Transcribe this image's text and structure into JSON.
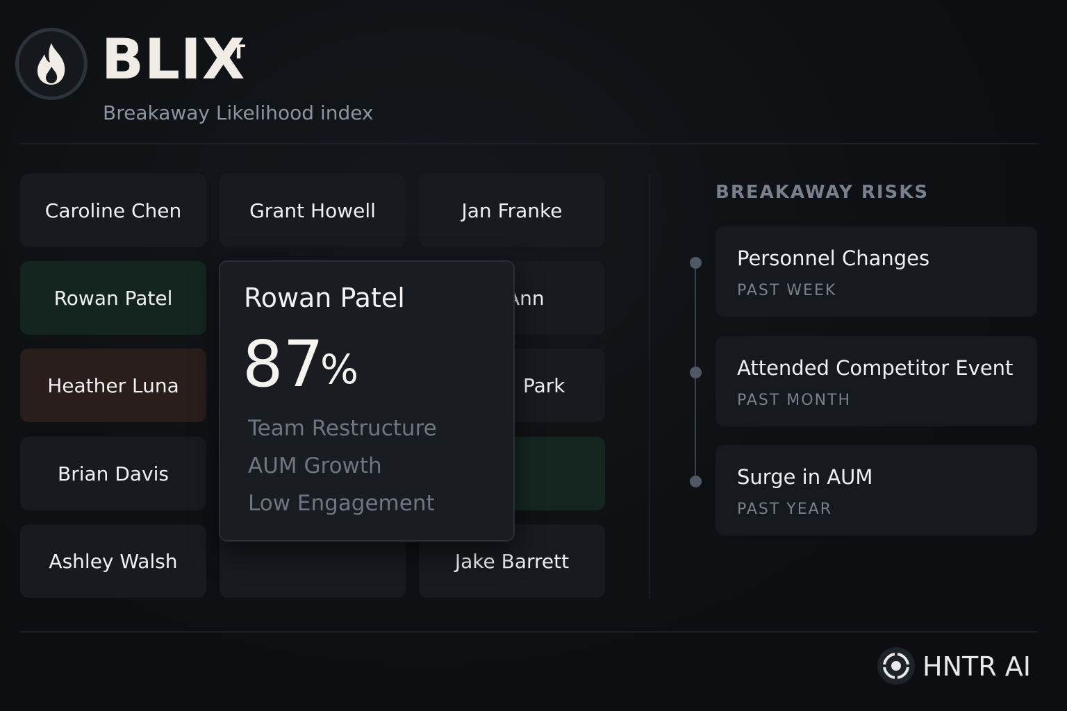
{
  "header": {
    "brand": "BLIX",
    "brand_superscript": "T",
    "subtitle": "Breakaway Likelihood index",
    "logo_icon": "flame-icon"
  },
  "advisors": [
    {
      "name": "Caroline Chen",
      "tint": "default"
    },
    {
      "name": "Grant Howell",
      "tint": "default"
    },
    {
      "name": "Jan Franke",
      "tint": "default"
    },
    {
      "name": "Rowan Patel",
      "tint": "green"
    },
    {
      "name": "Ann",
      "tint": "default"
    },
    {
      "name": "Heather Luna",
      "tint": "brown"
    },
    {
      "name": "Park",
      "tint": "default"
    },
    {
      "name": "Brian Davis",
      "tint": "default"
    },
    {
      "name": "",
      "tint": "green"
    },
    {
      "name": "Ashley Walsh",
      "tint": "default"
    },
    {
      "name": "",
      "tint": "default"
    },
    {
      "name": "Jake Barrett",
      "tint": "default"
    }
  ],
  "popup": {
    "name": "Rowan Patel",
    "score": "87",
    "score_unit": "%",
    "factors": [
      "Team Restructure",
      "AUM Growth",
      "Low Engagement"
    ]
  },
  "risks": {
    "title": "BREAKAWAY RISKS",
    "items": [
      {
        "title": "Personnel Changes",
        "when": "PAST WEEK"
      },
      {
        "title": "Attended Competitor Event",
        "when": "PAST MONTH"
      },
      {
        "title": "Surge in AUM",
        "when": "PAST YEAR"
      }
    ]
  },
  "footer": {
    "brand": "HNTR AI",
    "logo_icon": "target-icon"
  },
  "colors": {
    "background": "#0d0f12",
    "tile": "#171a1f",
    "tile_green": "#142520",
    "tile_brown": "#2a1e1c",
    "muted_text": "#77808c"
  }
}
